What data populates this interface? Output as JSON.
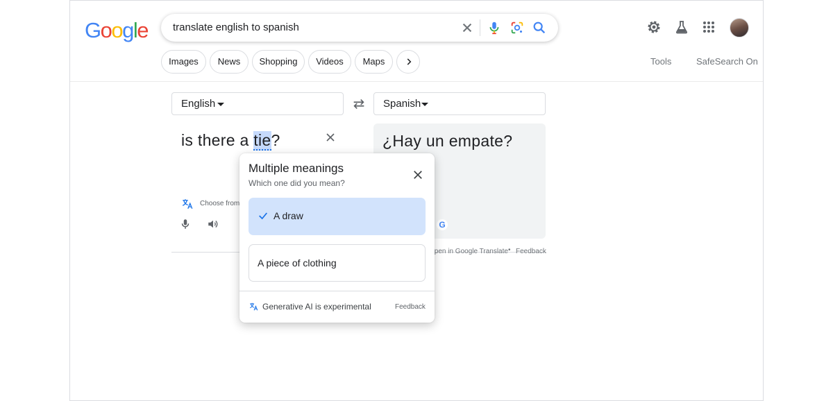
{
  "logo": {
    "letters": [
      "G",
      "o",
      "o",
      "g",
      "l",
      "e"
    ]
  },
  "search": {
    "query": "translate english to spanish"
  },
  "icons": {
    "clear": "close-icon",
    "voice": "mic-icon",
    "lens": "camera-lens-icon",
    "search": "search-icon",
    "settings": "gear-icon",
    "labs": "flask-icon",
    "apps": "grid-icon"
  },
  "nav": {
    "chips": [
      "Images",
      "News",
      "Shopping",
      "Videos",
      "Maps"
    ],
    "more_icon": "chevron-right-icon",
    "tools": "Tools",
    "safesearch": "SafeSearch On"
  },
  "translate": {
    "source_lang": "English",
    "target_lang": "Spanish",
    "source_before": "is there a ",
    "source_highlight": "tie",
    "source_after": "?",
    "target_text": "¿Hay un empate?",
    "choose_text": "Choose from",
    "open_in_translate": "Open in Google Translate",
    "separator": "•",
    "feedback": "Feedback"
  },
  "popup": {
    "title": "Multiple meanings",
    "subtitle": "Which one did you mean?",
    "options": [
      {
        "label": "A draw",
        "selected": true
      },
      {
        "label": "A piece of clothing",
        "selected": false
      }
    ],
    "ai_note": "Generative AI is experimental",
    "feedback": "Feedback"
  },
  "colors": {
    "accent": "#1a73e8",
    "selected_option_bg": "#d2e3fc",
    "highlight_bg": "#c6dafc"
  }
}
